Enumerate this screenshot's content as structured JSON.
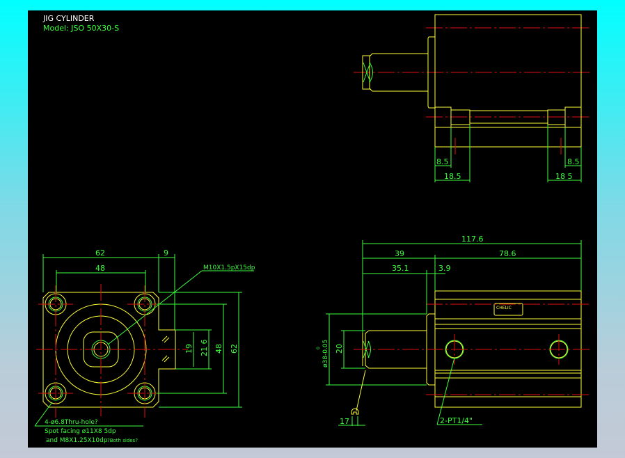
{
  "title": "JIG CYLINDER",
  "model": "Model:  JSO 50X30-S",
  "colors": {
    "background_top": "#00ffff",
    "background_bottom": "#c3c9d6",
    "drawing_bg": "#000000",
    "outline": "#ffff3a",
    "dimension": "#3dff3d",
    "centerline": "#e01010"
  },
  "front_view": {
    "dim_width": "62",
    "dim_offset": "9",
    "dim_bolt_pitch": "48",
    "dim_19": "19",
    "dim_21_6": "21 6",
    "dim_48_v": "48",
    "dim_62_v": "62",
    "thread_note": "M10X1.5pX15dp",
    "hole_note_1": "4-ø6.8Thru-hole?",
    "hole_note_2": "Spot facing  ø11X8 5dp",
    "hole_note_3": "and M8X1.25X10dp",
    "hole_note_4": "?Both sides?"
  },
  "top_view": {
    "dim_left_8_5": "8.5",
    "dim_left_18_5": "18.5",
    "dim_right_8_5": "8.5",
    "dim_right_18_5": "18 5"
  },
  "side_view": {
    "dim_total": "117.6",
    "dim_39": "39",
    "dim_78_6": "78.6",
    "dim_35_1": "35.1",
    "dim_3_9": "3.9",
    "dim_dia": "ø38-0.05",
    "dim_dia_upper": "0",
    "dim_20": "20",
    "dim_17": "17",
    "port_note": "2-PT1/4\"",
    "nameplate": "CHELIC"
  }
}
